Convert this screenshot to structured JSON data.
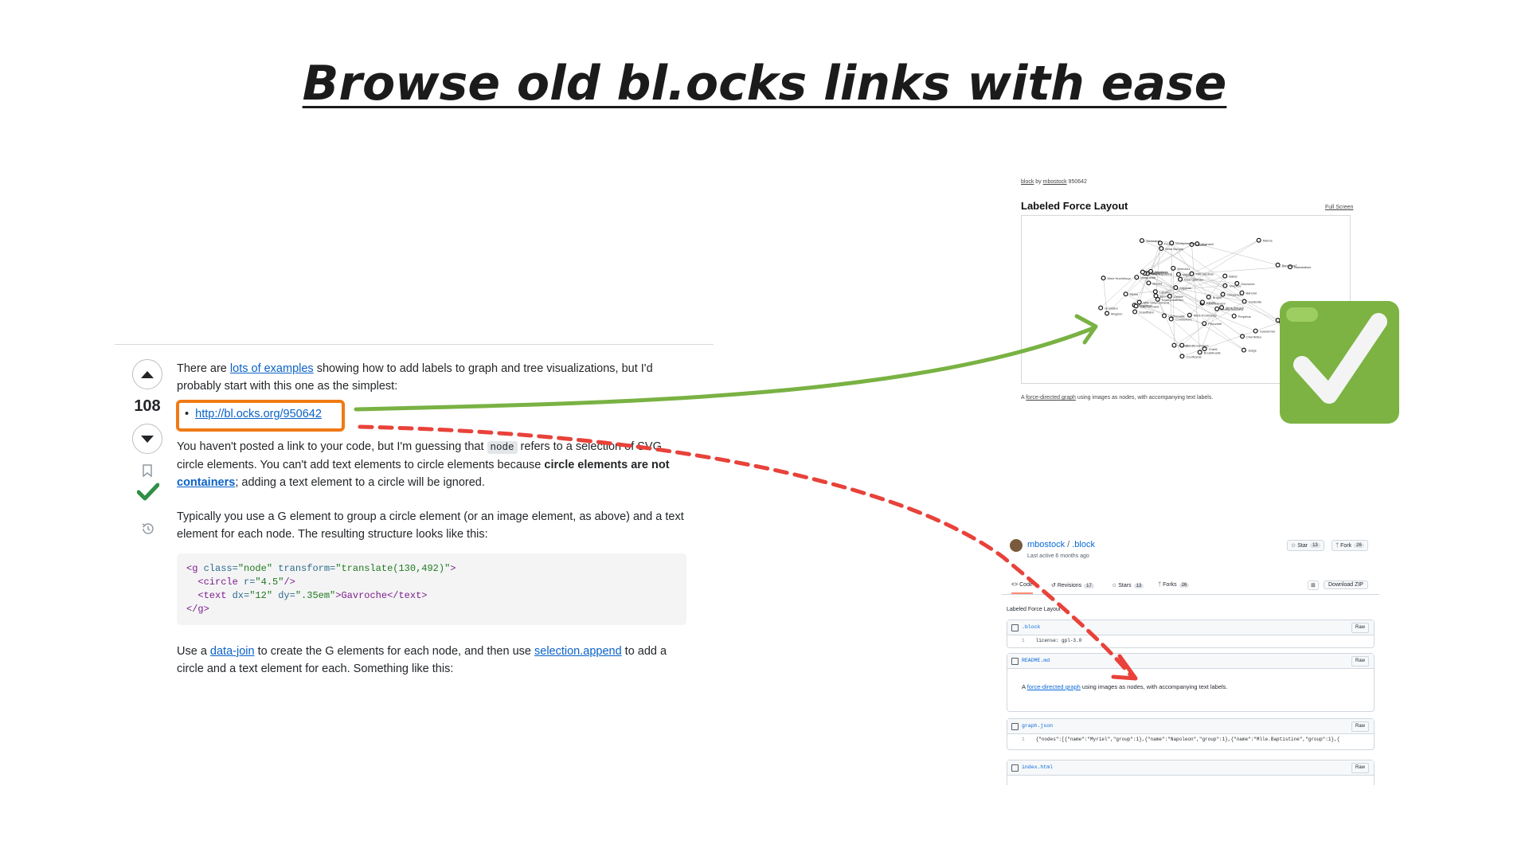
{
  "title": "Browse old bl.ocks links with ease",
  "answer": {
    "score": "108",
    "p1_a": "There are ",
    "p1_link": "lots of examples",
    "p1_b": " showing how to add labels to graph and tree visualizations, but I'd probably start with this one as the simplest:",
    "bullet_link": "http://bl.ocks.org/950642",
    "p2_a": "You haven't posted a link to your code, but I'm guessing that ",
    "p2_code": "node",
    "p2_b": " refers to a selection of SVG circle elements. You can't add text elements to circle elements because ",
    "p2_bold": "circle elements are not ",
    "p2_link": "containers",
    "p2_c": "; adding a text element to a circle will be ignored.",
    "p3": "Typically you use a G element to group a circle element (or an image element, as above) and a text element for each node. The resulting structure looks like this:",
    "code": {
      "l1_open": "<g ",
      "l1_attr1": "class=",
      "l1_val1": "\"node\"",
      "l1_attr2": " transform=",
      "l1_val2": "\"translate(130,492)\"",
      "l1_close": ">",
      "l2_open": "  <circle ",
      "l2_attr": "r=",
      "l2_val": "\"4.5\"",
      "l2_close": "/>",
      "l3_open": "  <text ",
      "l3_attr1": "dx=",
      "l3_val1": "\"12\"",
      "l3_attr2": " dy=",
      "l3_val2": "\".35em\"",
      "l3_mid": ">Gavroche</text>",
      "l4": "</g>"
    },
    "p4_a": "Use a ",
    "p4_link1": "data-join",
    "p4_b": " to create the G elements for each node, and then use ",
    "p4_link2": "selection.append",
    "p4_c": " to add a circle and a text element for each. Something like this:"
  },
  "block": {
    "by_a": "block",
    "by_b": " by ",
    "by_user": "mbostock",
    "by_id": " 950642",
    "title": "Labeled Force Layout",
    "full_screen": "Full Screen",
    "caption_a": "A ",
    "caption_link": "force-directed graph",
    "caption_b": " using images as nodes, with accompanying text labels.",
    "node_labels": [
      "Myriel",
      "Mme Burgon",
      "Napoleon",
      "Gribier",
      "Mlle Baptistine",
      "Cravatte",
      "Champtercier",
      "Labarre",
      "Valjean",
      "Marguerite",
      "Fauchelevent",
      "Bamatabois",
      "Perpetue",
      "Simplice",
      "Scaufflaire",
      "Woman1",
      "Judge",
      "Champmathieu",
      "Brevet",
      "Chenildieu",
      "Cochepaille",
      "Pontmercy",
      "Boulatruelle",
      "Eponine",
      "Anzelma",
      "Woman2",
      "MotherInnocent",
      "Gribier",
      "Jondrette",
      "Mme Burgon",
      "Gavroche",
      "Gillenormand",
      "Magnon",
      "Mlle Gillenormand",
      "Mme Pontmercy",
      "Mlle Vaubois",
      "Lt Gillenormand",
      "Marius",
      "BaronessT",
      "Mabeuf",
      "Enjolras",
      "Combeferre",
      "Prouvaire",
      "Feuilly",
      "Courfeyrac",
      "Bahorel",
      "Bossuet",
      "Joly",
      "Grantaire",
      "MotherPlutarch",
      "Gueulemer",
      "Babet",
      "Claquesous",
      "Montparnasse",
      "Toussaint",
      "Child1",
      "Child2",
      "Brujon",
      "Mme Hucheloup"
    ]
  },
  "gist": {
    "owner": "mbostock",
    "slash": " / ",
    "repo": ".block",
    "last_active": "Last active 6 months ago",
    "star_label": "Star",
    "star_count": "13",
    "fork_label": "Fork",
    "fork_count": "26",
    "tabs": [
      {
        "label": "Code",
        "count": ""
      },
      {
        "label": "Revisions",
        "count": "17"
      },
      {
        "label": "Stars",
        "count": "13"
      },
      {
        "label": "Forks",
        "count": "26"
      }
    ],
    "download": "Download ZIP",
    "description": "Labeled Force Layout",
    "raw": "Raw",
    "files": [
      {
        "name": ".block",
        "line_no": "1",
        "line": "license: gpl-3.0"
      },
      {
        "name": "README.md"
      },
      {
        "name": "graph.json",
        "line_no": "1",
        "line": "{\"nodes\":[{\"name\":\"Myriel\",\"group\":1},{\"name\":\"Napoleon\",\"group\":1},{\"name\":\"Mlle.Baptistine\",\"group\":1},{"
      },
      {
        "name": "index.html"
      }
    ],
    "readme_a": "A ",
    "readme_link": "force-directed graph",
    "readme_b": " using images as nodes, with accompanying text labels."
  },
  "colors": {
    "highlight_box": "#f07a14",
    "good_arrow": "#79b243",
    "bad_arrow": "#e8423a",
    "checkmark_bg": "#7cb342",
    "accepted": "#2f8f46",
    "link": "#0a62c7"
  }
}
